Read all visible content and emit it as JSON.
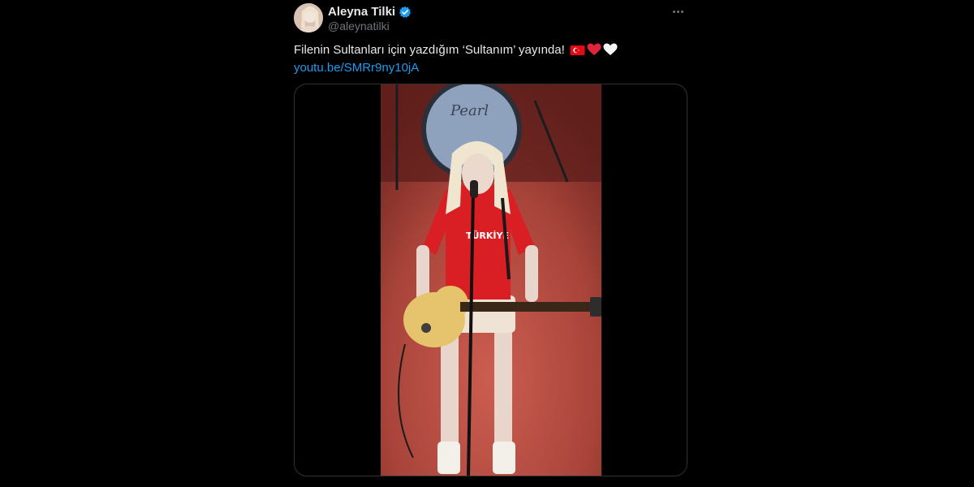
{
  "tweet": {
    "display_name": "Aleyna Tilki",
    "handle": "@aleynatilki",
    "text": "Filenin Sultanları için yazdığım ‘Sultanım’ yayında!",
    "link": "youtu.be/SMRr9ny10jA",
    "emojis": [
      "turkey-flag",
      "red-heart",
      "white-heart"
    ]
  },
  "media": {
    "drum_brand": "Pearl",
    "shirt_text": "TÜRKİYE"
  },
  "colors": {
    "background": "#000000",
    "text": "#e7e9ea",
    "secondary": "#71767b",
    "link": "#1d9bf0",
    "verified": "#1d9bf0",
    "border": "#2f3336"
  }
}
